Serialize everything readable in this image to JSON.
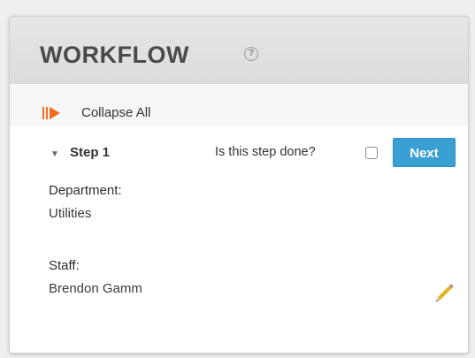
{
  "workflow": {
    "title": "WORKFLOW",
    "help_icon": "question-circle-icon",
    "collapse_icon": "collapse-arrows-icon",
    "collapse_label": "Collapse All"
  },
  "step": {
    "caret_icon": "caret-down-icon",
    "title": "Step 1",
    "done_question": "Is this step done?",
    "done_checked": false,
    "next_label": "Next"
  },
  "fields": [
    {
      "label": "Department:",
      "value": "Utilities"
    },
    {
      "label": "Staff:",
      "value": "Brendon Gamm"
    }
  ],
  "edit_icon": "pencil-icon",
  "colors": {
    "accent_orange": "#f26b21",
    "next_button": "#3aa0d3"
  }
}
